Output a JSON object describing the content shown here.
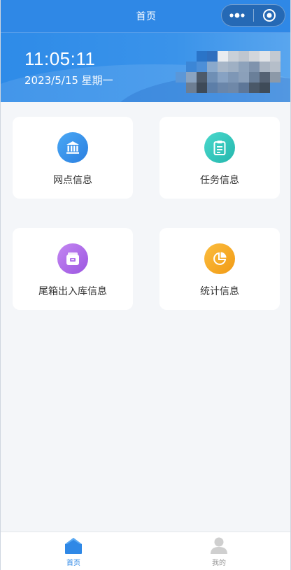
{
  "nav": {
    "title": "首页",
    "more_icon": "more-dots-icon",
    "close_icon": "target-circle-icon"
  },
  "banner": {
    "time": "11:05:11",
    "date": "2023/5/15 星期一"
  },
  "cards": [
    {
      "label": "网点信息",
      "icon": "bank-building-icon",
      "color": "#2f8de8"
    },
    {
      "label": "任务信息",
      "icon": "clipboard-icon",
      "color": "#2ec7bd"
    },
    {
      "label": "尾箱出入库信息",
      "icon": "box-icon",
      "color": "#b06ae8"
    },
    {
      "label": "统计信息",
      "icon": "pie-chart-icon",
      "color": "#f4a320"
    }
  ],
  "tabbar": {
    "items": [
      {
        "label": "首页",
        "icon": "home-icon",
        "active": true
      },
      {
        "label": "我的",
        "icon": "user-icon",
        "active": false
      }
    ],
    "active_color": "#2f88e6",
    "inactive_color": "#999999"
  }
}
